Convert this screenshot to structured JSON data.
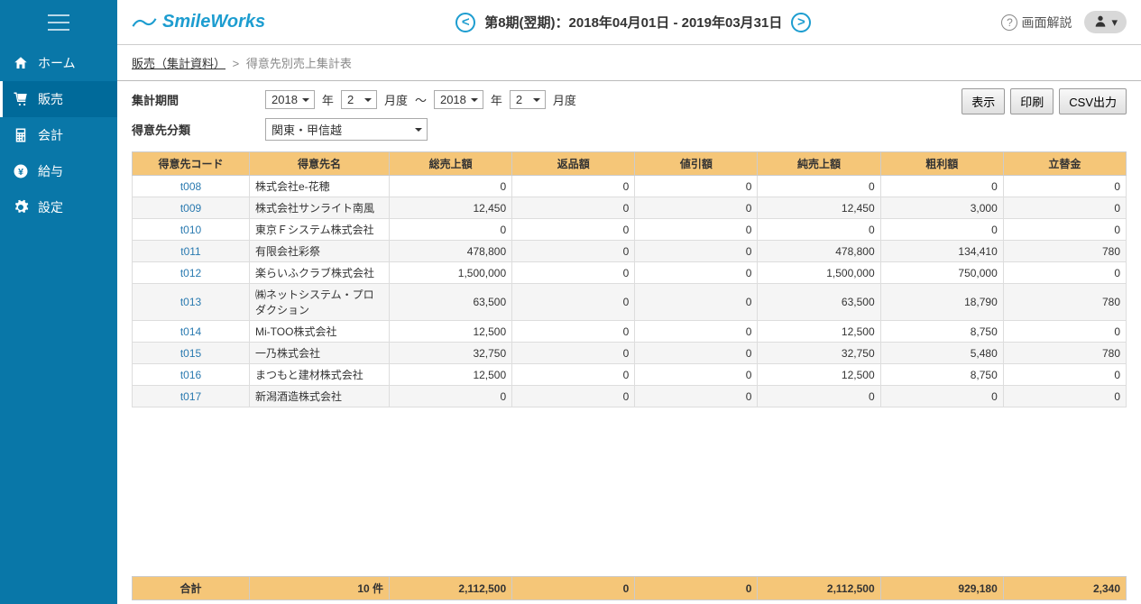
{
  "header": {
    "logo": "SmileWorks",
    "period_label": "第8期(翌期)：2018年04月01日 - 2019年03月31日",
    "help_label": "画面解説"
  },
  "sidebar": {
    "items": [
      {
        "label": "ホーム",
        "icon": "home"
      },
      {
        "label": "販売",
        "icon": "cart"
      },
      {
        "label": "会計",
        "icon": "calc"
      },
      {
        "label": "給与",
        "icon": "yen"
      },
      {
        "label": "設定",
        "icon": "gear"
      }
    ]
  },
  "breadcrumb": {
    "link": "販売（集計資料）",
    "sep": ">",
    "current": "得意先別売上集計表"
  },
  "filters": {
    "period_label": "集計期間",
    "year1": "2018",
    "year_suffix": "年",
    "month1": "2",
    "month_suffix": "月度",
    "tilde": "～",
    "year2": "2018",
    "month2": "2",
    "category_label": "得意先分類",
    "category_value": "関東・甲信越"
  },
  "buttons": {
    "show": "表示",
    "print": "印刷",
    "csv": "CSV出力"
  },
  "table": {
    "headers": [
      "得意先コード",
      "得意先名",
      "総売上額",
      "返品額",
      "値引額",
      "純売上額",
      "粗利額",
      "立替金"
    ],
    "rows": [
      {
        "code": "t008",
        "name": "株式会社e-花穂",
        "gross": "0",
        "returns": "0",
        "discount": "0",
        "net": "0",
        "profit": "0",
        "advance": "0"
      },
      {
        "code": "t009",
        "name": "株式会社サンライト南風",
        "gross": "12,450",
        "returns": "0",
        "discount": "0",
        "net": "12,450",
        "profit": "3,000",
        "advance": "0"
      },
      {
        "code": "t010",
        "name": "東京Ｆシステム株式会社",
        "gross": "0",
        "returns": "0",
        "discount": "0",
        "net": "0",
        "profit": "0",
        "advance": "0"
      },
      {
        "code": "t011",
        "name": "有限会社彩祭",
        "gross": "478,800",
        "returns": "0",
        "discount": "0",
        "net": "478,800",
        "profit": "134,410",
        "advance": "780"
      },
      {
        "code": "t012",
        "name": "楽らいふクラブ株式会社",
        "gross": "1,500,000",
        "returns": "0",
        "discount": "0",
        "net": "1,500,000",
        "profit": "750,000",
        "advance": "0"
      },
      {
        "code": "t013",
        "name": "㈱ネットシステム・プロダクション",
        "gross": "63,500",
        "returns": "0",
        "discount": "0",
        "net": "63,500",
        "profit": "18,790",
        "advance": "780"
      },
      {
        "code": "t014",
        "name": "Mi-TOO株式会社",
        "gross": "12,500",
        "returns": "0",
        "discount": "0",
        "net": "12,500",
        "profit": "8,750",
        "advance": "0"
      },
      {
        "code": "t015",
        "name": "一乃株式会社",
        "gross": "32,750",
        "returns": "0",
        "discount": "0",
        "net": "32,750",
        "profit": "5,480",
        "advance": "780"
      },
      {
        "code": "t016",
        "name": "まつもと建材株式会社",
        "gross": "12,500",
        "returns": "0",
        "discount": "0",
        "net": "12,500",
        "profit": "8,750",
        "advance": "0"
      },
      {
        "code": "t017",
        "name": "新潟酒造株式会社",
        "gross": "0",
        "returns": "0",
        "discount": "0",
        "net": "0",
        "profit": "0",
        "advance": "0"
      }
    ]
  },
  "totals": {
    "label": "合計",
    "count": "10 件",
    "gross": "2,112,500",
    "returns": "0",
    "discount": "0",
    "net": "2,112,500",
    "profit": "929,180",
    "advance": "2,340"
  }
}
